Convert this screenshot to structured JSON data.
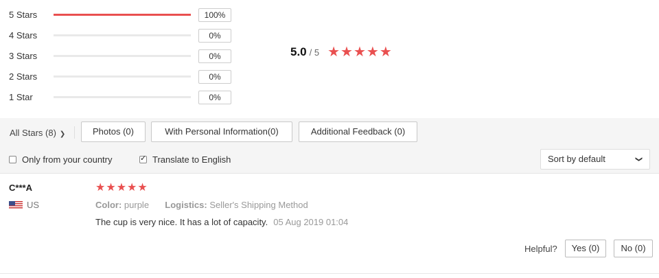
{
  "histogram": {
    "rows": [
      {
        "label": "5 Stars",
        "percent_text": "100%",
        "fraction": 1.0
      },
      {
        "label": "4 Stars",
        "percent_text": "0%",
        "fraction": 0
      },
      {
        "label": "3 Stars",
        "percent_text": "0%",
        "fraction": 0
      },
      {
        "label": "2 Stars",
        "percent_text": "0%",
        "fraction": 0
      },
      {
        "label": "1 Star",
        "percent_text": "0%",
        "fraction": 0
      }
    ]
  },
  "summary": {
    "score": "5.0",
    "out_of": "/ 5",
    "stars": 5
  },
  "filters": {
    "all_stars": "All Stars (8)",
    "photos": "Photos (0)",
    "personal_info": "With Personal Information(0)",
    "additional_feedback": "Additional Feedback (0)"
  },
  "options": {
    "only_country": {
      "label": "Only from your country",
      "checked": false
    },
    "translate": {
      "label": "Translate to English",
      "checked": true
    },
    "sort": "Sort by default"
  },
  "review": {
    "user": "C***A",
    "country": "US",
    "stars": 5,
    "color_label": "Color:",
    "color_value": "purple",
    "logistics_label": "Logistics:",
    "logistics_value": "Seller's Shipping Method",
    "text": "The cup is very nice. It has a lot of capacity.",
    "date": "05 Aug 2019 01:04",
    "helpful_label": "Helpful?",
    "yes": "Yes (0)",
    "no": "No (0)"
  },
  "colors": {
    "accent": "#e95050"
  },
  "icons": [
    "star-icon",
    "chevron-down-icon",
    "us-flag-icon",
    "checkbox-icon"
  ]
}
